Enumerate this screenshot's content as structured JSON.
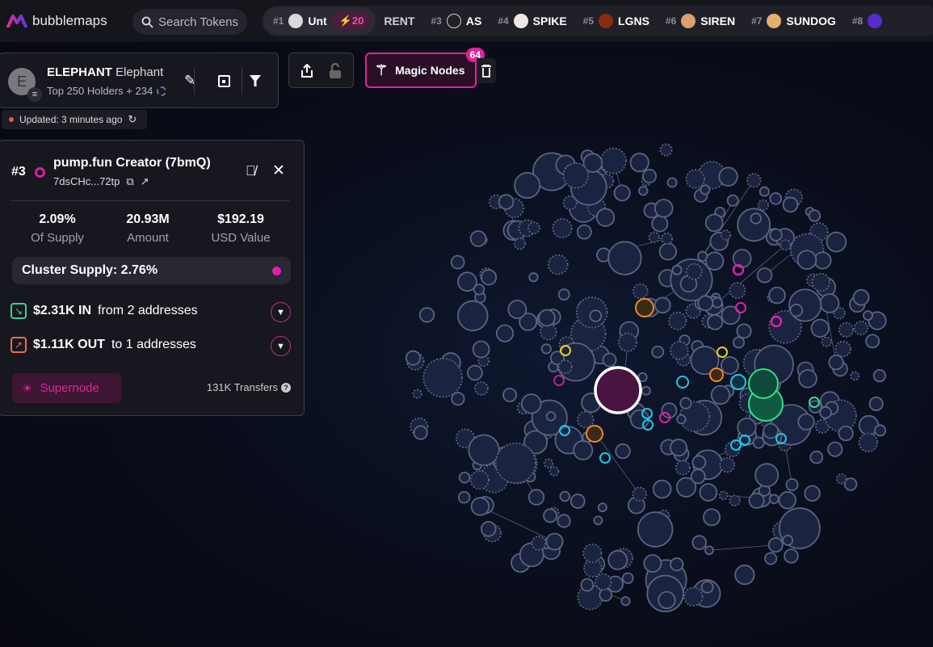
{
  "brand": {
    "name": "bubblemaps"
  },
  "search": {
    "placeholder": "Search Tokens"
  },
  "ticker": [
    {
      "rank": "#1",
      "name": "Unt",
      "boost": "20",
      "color": "#d9d9d9"
    },
    {
      "rank": "",
      "name": "RENT",
      "color": ""
    },
    {
      "rank": "#3",
      "name": "AS",
      "color": "#222"
    },
    {
      "rank": "#4",
      "name": "SPIKE",
      "color": "#f2e6e6"
    },
    {
      "rank": "#5",
      "name": "LGNS",
      "color": "#8a2a12"
    },
    {
      "rank": "#6",
      "name": "SIREN",
      "color": "#d8a070"
    },
    {
      "rank": "#7",
      "name": "SUNDOG",
      "color": "#e3b070"
    },
    {
      "rank": "#8",
      "name": "",
      "color": "#5a2ad0"
    }
  ],
  "token": {
    "avatar_letter": "E",
    "symbol": "ELEPHANT",
    "name": "Elephant",
    "subtitle": "Top 250 Holders + 234",
    "updated": "Updated: 3 minutes ago"
  },
  "magic": {
    "label": "Magic Nodes",
    "count": "64"
  },
  "panel": {
    "rank": "#3",
    "title": "pump.fun Creator (7bmQ)",
    "address": "7dsCHc...72tp",
    "stats": [
      {
        "value": "2.09%",
        "label": "Of Supply"
      },
      {
        "value": "20.93M",
        "label": "Amount"
      },
      {
        "value": "$192.19",
        "label": "USD Value"
      }
    ],
    "cluster": "Cluster Supply: 2.76%",
    "in": {
      "amount": "$2.31K IN",
      "detail": "from 2 addresses"
    },
    "out": {
      "amount": "$1.11K OUT",
      "detail": "to 1 addresses"
    },
    "supernode": "Supernode",
    "transfers": "131K Transfers"
  },
  "colors": {
    "accent": "#e0249a",
    "in": "#3ecf8e",
    "out": "#f06a5a",
    "cyan": "#1ec8e6",
    "orange": "#f08a1e",
    "yellow": "#e6d21e",
    "green": "#2ee08a",
    "node": "#5a6480"
  }
}
